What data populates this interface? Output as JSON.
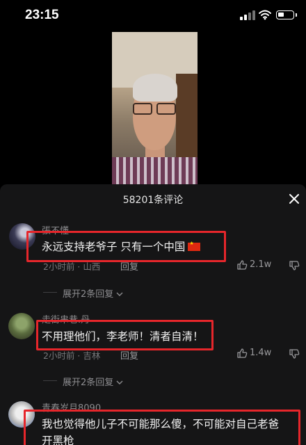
{
  "status": {
    "time": "23:15"
  },
  "panel": {
    "title": "58201条评论"
  },
  "comments": [
    {
      "username": "張不懂",
      "text": "永远支持老爷子 只有一个中国",
      "time": "2小时前",
      "location": "山西",
      "reply_label": "回复",
      "likes": "2.1w",
      "expand_label": "展开2条回复"
    },
    {
      "username": "走街串巷.丹",
      "text": "不用理他们，李老师！清者自清！",
      "time": "2小时前",
      "location": "吉林",
      "reply_label": "回复",
      "likes": "1.4w",
      "expand_label": "展开2条回复"
    },
    {
      "username": "青春岁月8090",
      "text_line1": "我也觉得他儿子不可能那么傻，不可能对自己老爸",
      "text_line2": "开黑枪"
    }
  ],
  "colors": {
    "highlight": "#e6262b",
    "panel_bg": "#151516"
  },
  "icons": [
    "signal-icon",
    "wifi-icon",
    "battery-icon",
    "close-icon",
    "thumb-up-icon",
    "thumb-down-icon",
    "chevron-down-icon",
    "china-flag-emoji"
  ]
}
